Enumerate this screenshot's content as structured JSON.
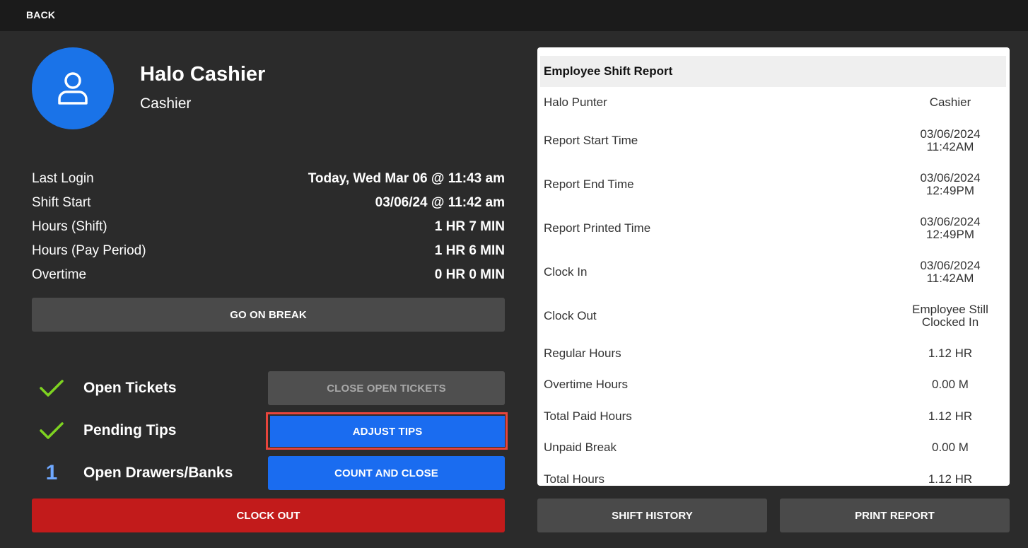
{
  "topbar": {
    "back_label": "BACK"
  },
  "employee": {
    "name": "Halo Cashier",
    "role": "Cashier",
    "avatar_icon": "user-icon"
  },
  "stats": [
    {
      "label": "Last Login",
      "value": "Today, Wed Mar 06 @ 11:43 am"
    },
    {
      "label": "Shift Start",
      "value": "03/06/24 @ 11:42 am"
    },
    {
      "label": "Hours (Shift)",
      "value": "1 HR 7 MIN"
    },
    {
      "label": "Hours (Pay Period)",
      "value": "1 HR 6 MIN"
    },
    {
      "label": "Overtime",
      "value": "0 HR 0 MIN"
    }
  ],
  "buttons": {
    "go_on_break": "GO ON BREAK",
    "close_open_tickets": "CLOSE OPEN TICKETS",
    "adjust_tips": "ADJUST TIPS",
    "count_and_close": "COUNT AND CLOSE",
    "clock_out": "CLOCK OUT",
    "shift_history": "SHIFT HISTORY",
    "print_report": "PRINT REPORT"
  },
  "checklist": {
    "open_tickets": {
      "label": "Open Tickets",
      "status_icon": "checkmark-icon"
    },
    "pending_tips": {
      "label": "Pending Tips",
      "status_icon": "checkmark-icon"
    },
    "open_drawers": {
      "label": "Open Drawers/Banks",
      "count": "1"
    }
  },
  "report": {
    "title": "Employee Shift Report",
    "rows": [
      {
        "label": "Halo Punter",
        "value": "Cashier",
        "value2": ""
      },
      {
        "label": "Report Start Time",
        "value": "03/06/2024",
        "value2": "11:42AM"
      },
      {
        "label": "Report End Time",
        "value": "03/06/2024",
        "value2": "12:49PM"
      },
      {
        "label": "Report Printed Time",
        "value": "03/06/2024",
        "value2": "12:49PM"
      },
      {
        "label": "Clock In",
        "value": "03/06/2024",
        "value2": "11:42AM"
      },
      {
        "label": "Clock Out",
        "value": "Employee Still",
        "value2": "Clocked In"
      },
      {
        "label": "Regular Hours",
        "value": "1.12 HR",
        "value2": ""
      },
      {
        "label": "Overtime Hours",
        "value": "0.00 M",
        "value2": ""
      },
      {
        "label": "Total Paid Hours",
        "value": "1.12 HR",
        "value2": ""
      },
      {
        "label": "Unpaid Break",
        "value": "0.00 M",
        "value2": ""
      },
      {
        "label": "Total Hours",
        "value": "1.12 HR",
        "value2": ""
      }
    ]
  },
  "colors": {
    "background": "#2b2b2b",
    "topbar": "#1b1b1b",
    "accent_blue": "#1a6cf0",
    "danger_red": "#c21b1b",
    "check_green": "#7ed321",
    "highlight_border": "#e8453c"
  }
}
